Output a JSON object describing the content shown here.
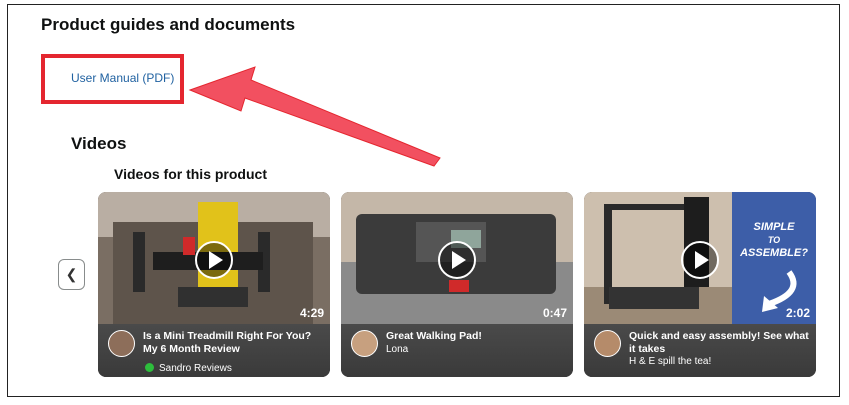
{
  "section": {
    "title": "Product guides and documents"
  },
  "documents": {
    "user_manual_label": "User Manual (PDF)"
  },
  "videos": {
    "heading": "Videos",
    "subheading": "Videos for this product",
    "items": [
      {
        "title": "Is a Mini Treadmill Right For You? My 6 Month Review",
        "author": "Sandro Reviews",
        "duration": "4:29"
      },
      {
        "title": "Great Walking Pad!",
        "author": "Lona",
        "duration": "0:47"
      },
      {
        "title": "Quick and easy assembly! See what it takes",
        "author": "H & E spill the tea!",
        "duration": "2:02"
      }
    ],
    "thumbnail_overlay_text": "SIMPLE TO ASSEMBLE?"
  },
  "colors": {
    "annotation_red": "#e4262f",
    "link_blue": "#2162a1",
    "online_green": "#2dbe3c"
  },
  "icons": {
    "prev": "chevron-left-icon",
    "play": "play-icon"
  }
}
